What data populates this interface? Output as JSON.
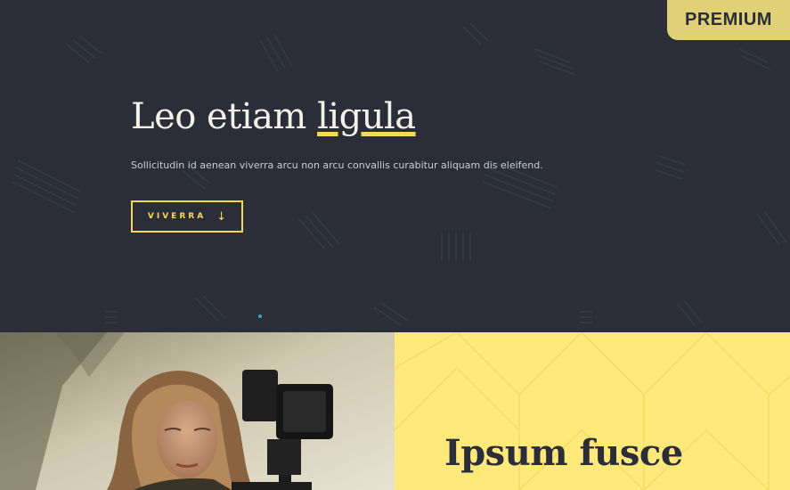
{
  "badge": {
    "label": "PREMIUM"
  },
  "hero": {
    "title_prefix": "Leo etiam ",
    "title_highlight": "ligula",
    "subtitle": "Sollicitudin id aenean viverra arcu non arcu convallis curabitur aliquam dis eleifend.",
    "cta_label": "VIVERRA",
    "cta_icon": "arrow-down-icon"
  },
  "section2": {
    "heading": "Ipsum fusce",
    "photo_subject": "woman-with-camera-photo"
  },
  "colors": {
    "hero_bg": "#2b2e39",
    "accent_yellow": "#f1d95a",
    "panel_yellow": "#ffe97a",
    "badge_bg": "#e0d076",
    "slider_dot": "#1fb0c9"
  }
}
